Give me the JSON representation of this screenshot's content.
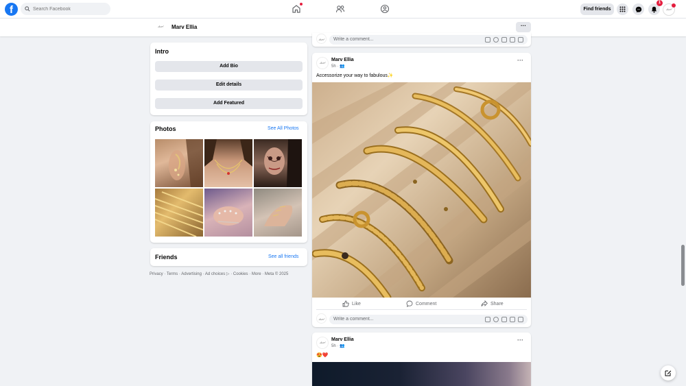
{
  "search": {
    "placeholder": "Search Facebook"
  },
  "topbar": {
    "find_friends": "Find friends",
    "notification_count": "1",
    "profile_avatar_text": "Ꮧ𝓊ℯ𝓁"
  },
  "profile_bar": {
    "name": "Marv Ellia",
    "more": "···",
    "avatar_text": "Ꮧ𝓊ℯ𝓁"
  },
  "intro": {
    "title": "Intro",
    "buttons": [
      "Add Bio",
      "Edit details",
      "Add Featured"
    ]
  },
  "photos": {
    "title": "Photos",
    "see_all": "See All Photos"
  },
  "friends": {
    "title": "Friends",
    "see_all": "See all friends"
  },
  "footer": "Privacy · Terms · Advertising · Ad choices ▷ · Cookies · More · Meta © 2025",
  "comment_placeholder": "Write a comment...",
  "posts": [
    {
      "author": "Marv Ellia",
      "time": "5h · 👥",
      "text": "Accessorize your way to fabulous✨",
      "actions": {
        "like": "Like",
        "comment": "Comment",
        "share": "Share"
      }
    },
    {
      "author": "Marv Ellia",
      "time": "5h · 👥",
      "text": "😍❤️"
    }
  ],
  "avatar_text": "Ꮧ𝓊ℯ𝓁",
  "colors": {
    "brand": "#1877f2",
    "notification": "#e41e3f",
    "background": "#f0f2f5"
  }
}
